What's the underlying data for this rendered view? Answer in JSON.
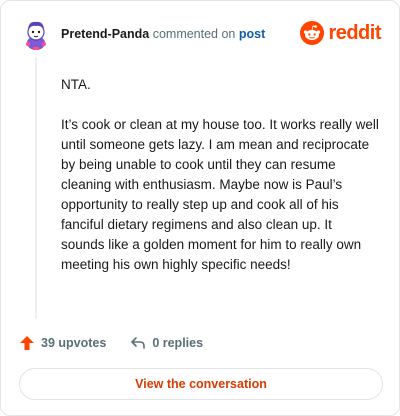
{
  "header": {
    "username": "Pretend-Panda",
    "action_text": "commented on",
    "post_link": "post"
  },
  "brand": {
    "logo_text": "reddit",
    "color": "#ff4500",
    "icon": "reddit-snoo-icon"
  },
  "comment": {
    "paragraphs": [
      "NTA.",
      "It’s cook or clean at my house too. It works really well until someone gets lazy. I am mean and reciprocate by being unable to cook until they can resume cleaning with enthusiasm. Maybe now is Paul’s opportunity to really step up and cook all of his fanciful dietary regimens and also clean up. It sounds like a golden moment for him to really own meeting his own highly specific needs!"
    ]
  },
  "footer": {
    "upvotes": "39 upvotes",
    "replies": "0 replies",
    "cta_label": "View the conversation",
    "upvote_color": "#ff4500"
  }
}
